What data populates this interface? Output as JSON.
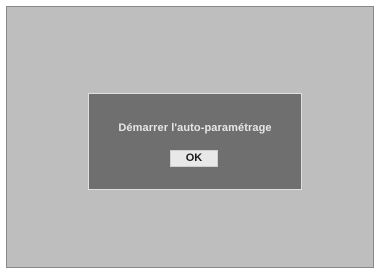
{
  "dialog": {
    "message": "Démarrer l'auto-paramétrage",
    "ok_label": "OK"
  },
  "colors": {
    "screen_background": "#bebebf",
    "dialog_background": "#6f6f70",
    "dialog_text": "#e6e6e6",
    "button_background": "#e8e8e8"
  }
}
